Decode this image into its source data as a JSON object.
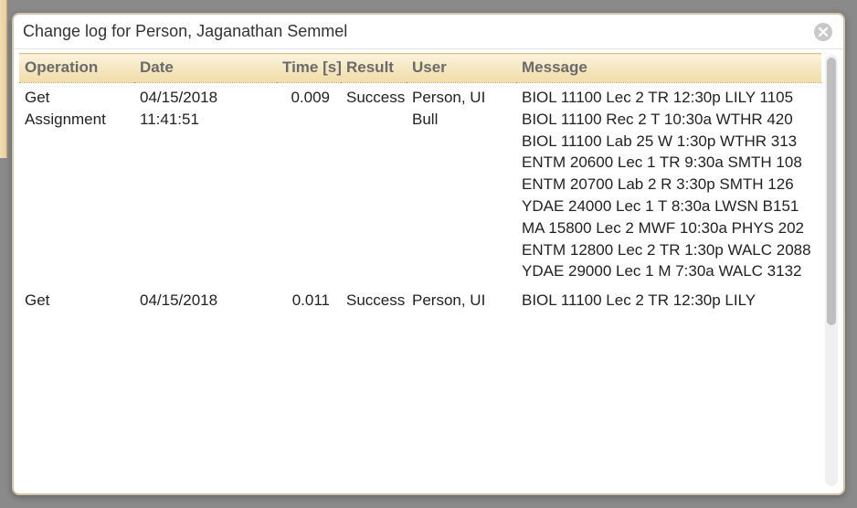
{
  "dialog": {
    "title": "Change log for Person, Jaganathan Semmel"
  },
  "columns": {
    "operation": "Operation",
    "date": "Date",
    "time": "Time [s]",
    "result": "Result",
    "user": "User",
    "message": "Message"
  },
  "rows": [
    {
      "operation": "Get Assignment",
      "date": "04/15/2018 11:41:51",
      "time": "0.009",
      "result": "Success",
      "user": "Person, UI Bull",
      "message": [
        "BIOL 11100 Lec 2 TR 12:30p LILY 1105",
        "BIOL 11100 Rec 2 T 10:30a WTHR 420",
        "BIOL 11100 Lab 25 W 1:30p WTHR 313",
        "ENTM 20600 Lec 1 TR 9:30a SMTH 108",
        "ENTM 20700 Lab 2 R 3:30p SMTH 126",
        "YDAE 24000 Lec 1 T 8:30a LWSN B151",
        "MA 15800 Lec 2 MWF 10:30a PHYS 202",
        "ENTM 12800 Lec 2 TR 1:30p WALC 2088",
        "YDAE 29000 Lec 1 M 7:30a WALC 3132"
      ]
    },
    {
      "operation": "Get",
      "date": "04/15/2018",
      "time": "0.011",
      "result": "Success",
      "user": "Person, UI",
      "message": [
        "BIOL 11100 Lec 2 TR 12:30p LILY"
      ]
    }
  ]
}
